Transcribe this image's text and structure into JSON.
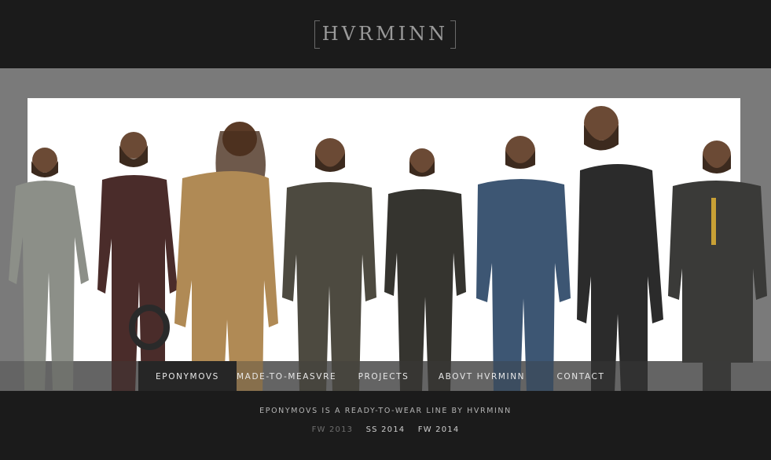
{
  "brand": {
    "logo_text": "HVRMINN"
  },
  "nav": {
    "items": [
      {
        "label": "EPONYMOVS",
        "active": true
      },
      {
        "label": "MADE-TO-MEASVRE",
        "active": false
      },
      {
        "label": "PROJECTS",
        "active": false
      },
      {
        "label": "ABOVT HVRMINN",
        "active": false
      },
      {
        "label": "CONTACT",
        "active": false
      }
    ]
  },
  "footer": {
    "tagline": "EPONYMOVS IS A READY-TO-WEAR LINE BY HVRMINN",
    "seasons": [
      {
        "label": "FW 2013",
        "current": false
      },
      {
        "label": "SS 2014",
        "current": true
      },
      {
        "label": "FW 2014",
        "current": true
      }
    ]
  },
  "hero": {
    "image_alt": "Eight bearded men in tailored suits",
    "suit_colors": [
      "#8c8f88",
      "#4a2c2a",
      "#b08a55",
      "#4d4a40",
      "#35342f",
      "#3d5673",
      "#2b2b2b",
      "#3a3a38"
    ]
  }
}
